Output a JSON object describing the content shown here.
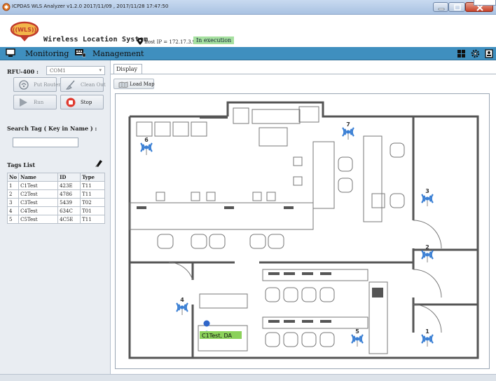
{
  "window": {
    "title": "ICPDAS WLS Analyzer v1.2.0 2017/11/09 , 2017/11/28 17:47:50"
  },
  "header": {
    "logo_text": "((WLS))",
    "brand": "Wireless Location System",
    "host": "host IP = 172.17.3.93",
    "status": "In execution",
    "status_color": "#a6e0a0"
  },
  "menubar": {
    "color": "#3f8fbf",
    "items": [
      {
        "label": "Monitoring",
        "icon": "monitor-icon"
      },
      {
        "label": "Management",
        "icon": "keyboard-icon"
      }
    ],
    "tools": [
      "grid-icon",
      "gear-icon",
      "user-icon"
    ]
  },
  "left": {
    "rfu_label": "RFU-400 :",
    "com_port": "COM1",
    "buttons": {
      "put_router": "Put Router",
      "clean_out": "Clean Out",
      "run": "Run",
      "stop": "Stop"
    },
    "search_label": "Search Tag ( Key in Name ) :",
    "search_value": "",
    "tags_title": "Tags List",
    "tags_headers": [
      "No",
      "Name",
      "ID",
      "Type"
    ],
    "tags": [
      {
        "no": "1",
        "name": "C1Test",
        "id": "423E",
        "type": "T11"
      },
      {
        "no": "2",
        "name": "C2Test",
        "id": "4786",
        "type": "T11"
      },
      {
        "no": "3",
        "name": "C3Test",
        "id": "5439",
        "type": "T02"
      },
      {
        "no": "4",
        "name": "C4Test",
        "id": "634C",
        "type": "T01"
      },
      {
        "no": "5",
        "name": "C5Test",
        "id": "4C5E",
        "type": "T11"
      }
    ]
  },
  "content": {
    "tab_display": "Display",
    "load_map": "Load Map",
    "map": {
      "routers": [
        "1",
        "2",
        "3",
        "4",
        "5",
        "6",
        "7"
      ],
      "router_color": "#3a7fd4",
      "tag_label": "C1Test, DA",
      "tag_label_color": "#8bd15a"
    }
  }
}
